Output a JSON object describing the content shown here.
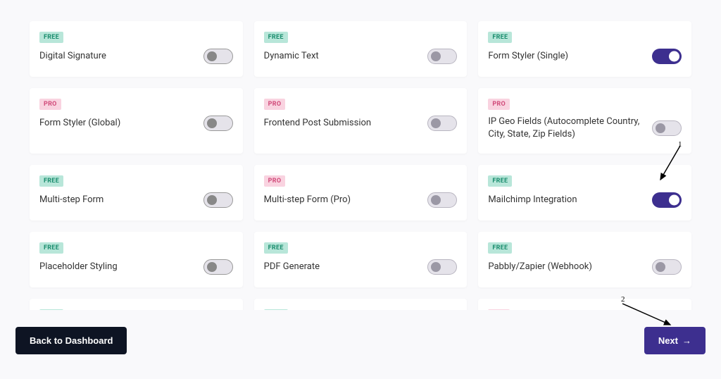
{
  "badges": {
    "free": "FREE",
    "pro": "PRO"
  },
  "cards": [
    {
      "tier": "free",
      "title": "Digital Signature",
      "enabled": false,
      "bordered": true
    },
    {
      "tier": "free",
      "title": "Dynamic Text",
      "enabled": false,
      "bordered": false
    },
    {
      "tier": "free",
      "title": "Form Styler (Single)",
      "enabled": true,
      "bordered": false
    },
    {
      "tier": "pro",
      "title": "Form Styler (Global)",
      "enabled": false,
      "bordered": true
    },
    {
      "tier": "pro",
      "title": "Frontend Post Submission",
      "enabled": false,
      "bordered": false
    },
    {
      "tier": "pro",
      "title": "IP Geo Fields (Autocomplete Country, City, State, Zip Fields)",
      "enabled": false,
      "bordered": false
    },
    {
      "tier": "free",
      "title": "Multi-step Form",
      "enabled": false,
      "bordered": true
    },
    {
      "tier": "pro",
      "title": "Multi-step Form (Pro)",
      "enabled": false,
      "bordered": false
    },
    {
      "tier": "free",
      "title": "Mailchimp Integration",
      "enabled": true,
      "bordered": false
    },
    {
      "tier": "free",
      "title": "Placeholder Styling",
      "enabled": false,
      "bordered": true
    },
    {
      "tier": "free",
      "title": "PDF Generate",
      "enabled": false,
      "bordered": false
    },
    {
      "tier": "free",
      "title": "Pabbly/Zapier (Webhook)",
      "enabled": false,
      "bordered": false
    }
  ],
  "partial_row": [
    {
      "tier": "free"
    },
    {
      "tier": "free"
    },
    {
      "tier": "pro"
    }
  ],
  "footer": {
    "back_label": "Back to Dashboard",
    "next_label": "Next"
  },
  "annotations": {
    "a1": "1",
    "a2": "2"
  }
}
